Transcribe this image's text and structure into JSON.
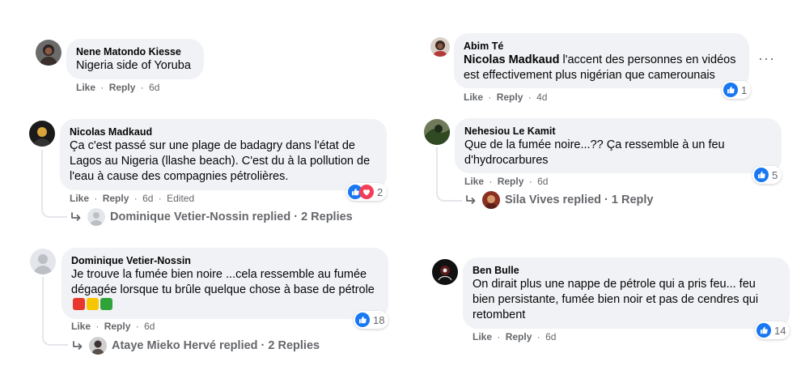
{
  "colors": {
    "bubble": "#f0f2f5",
    "meta": "#65676b",
    "like_blue": "#1877f2",
    "love_red": "#f33e58"
  },
  "common": {
    "like": "Like",
    "reply": "Reply",
    "dot": "·"
  },
  "comments": [
    {
      "author": "Nene Matondo Kiesse",
      "text": "Nigeria side of Yoruba",
      "time": "6d"
    },
    {
      "author": "Nicolas Madkaud",
      "text": "Ça c'est passé sur une plage de badagry dans l'état de Lagos au Nigeria (llashe beach). C'est du à la pollution de l'eau à cause des compagnies pétrolières.",
      "time": "6d",
      "edited": "Edited",
      "reactions": "2",
      "replies": {
        "label": "Dominique Vetier-Nossin replied · 2 Replies"
      }
    },
    {
      "author": "Dominique Vetier-Nossin",
      "text": "Je trouve la fumée bien noire ...cela ressemble au fumée dégagée lorsque tu brûle quelque chose à base de pétrole",
      "emojis": [
        "red-square",
        "yellow-square",
        "green-square"
      ],
      "time": "6d",
      "reactions": "18",
      "replies": {
        "label": "Ataye Mieko Hervé replied · 2 Replies"
      }
    },
    {
      "author": "Abim Té",
      "mention": "Nicolas Madkaud",
      "text": " l'accent des personnes en vidéos est effectivement plus nigérian que camerounais",
      "time": "4d",
      "reactions": "1",
      "more": "···"
    },
    {
      "author": "Nehesiou Le Kamit",
      "text": "Que de la fumée noire...?? Ça ressemble à un feu d'hydrocarbures",
      "time": "6d",
      "reactions": "5",
      "replies": {
        "label": "Sila Vives replied · 1 Reply"
      }
    },
    {
      "author": "Ben Bulle",
      "text": "On dirait plus une nappe de pétrole qui a pris feu... feu bien persistante, fumée bien noir et pas de cendres qui retombent",
      "time": "6d",
      "reactions": "14"
    }
  ]
}
